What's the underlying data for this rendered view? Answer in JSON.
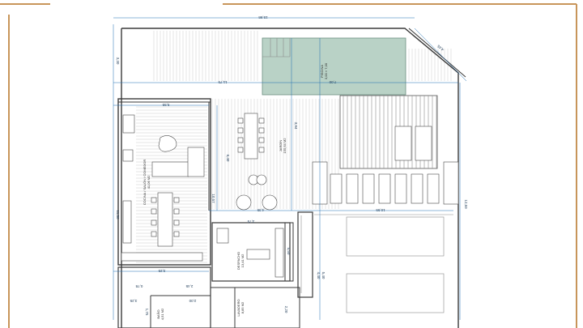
{
  "colors": {
    "frame": "#c8955a",
    "pool_fill": "#b9d2c6",
    "dimension": "#1f6fb2",
    "wall": "#3a3a3a"
  },
  "rooms": {
    "pool": {
      "name": "PISCINA",
      "size": "3,00 × 7,00"
    },
    "garden": {
      "name": "JARDÍN",
      "area": "155,64 M2"
    },
    "living": {
      "name": "COCINA / SALÓN / COMEDOR",
      "area": "41,06 M2"
    },
    "office": {
      "name": "DESPACHO",
      "area": "13,41 M2"
    },
    "laundry": {
      "name": "LAVADERO",
      "area": "8,85 M2"
    },
    "bath": {
      "name": "BAÑO",
      "area": "4,51 M2"
    }
  },
  "dimensions": {
    "top": "15,98",
    "pool_w": "7,00",
    "corner": "4,45",
    "left_top": "3,30",
    "terrace_w": "11,75",
    "living_w": "5,55",
    "garden_h": "3,94",
    "garden_mid": "6,40",
    "path_w": "10,55",
    "right_h": "12,59",
    "left_h": "11,56",
    "living_h": "10,57",
    "bottom_left": "3,25",
    "garden_bottom": "4,35",
    "office_w": "3,75",
    "office_h": "5,50",
    "stair": "4,40",
    "bath_w": "3,25",
    "bath_w2": "2,00",
    "bath_h": "1,75",
    "small1": "0,78",
    "small2": "2,45",
    "laundry_h": "2,20",
    "garden_low": "5,40"
  }
}
